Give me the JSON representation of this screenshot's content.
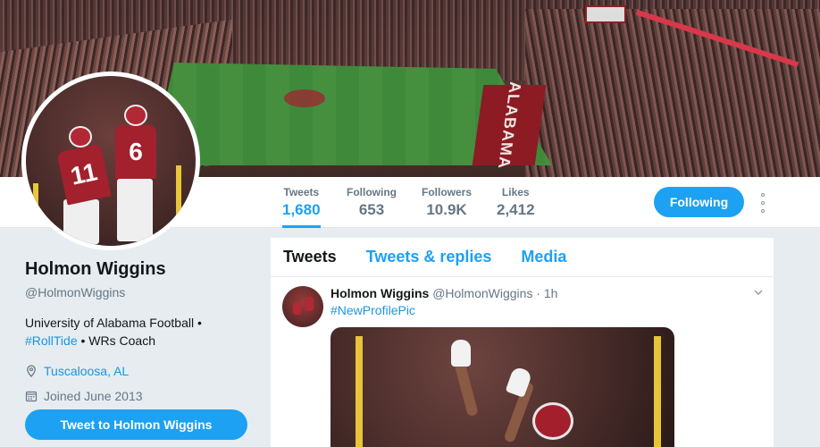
{
  "banner": {
    "endzone_text": "ALABAMA"
  },
  "avatar": {
    "jersey_1": "11",
    "jersey_2": "6"
  },
  "stats": [
    {
      "label": "Tweets",
      "value": "1,680"
    },
    {
      "label": "Following",
      "value": "653"
    },
    {
      "label": "Followers",
      "value": "10.9K"
    },
    {
      "label": "Likes",
      "value": "2,412"
    }
  ],
  "follow_button": "Following",
  "profile": {
    "name": "Holmon Wiggins",
    "handle": "@HolmonWiggins",
    "bio_text": "University of Alabama Football •",
    "bio_hashtag": "#RollTide",
    "bio_suffix": " • WRs Coach",
    "location": "Tuscaloosa, AL",
    "joined": "Joined June 2013",
    "tweet_to_button": "Tweet to Holmon Wiggins"
  },
  "timeline": {
    "tabs": [
      "Tweets",
      "Tweets & replies",
      "Media"
    ],
    "tweet": {
      "name": "Holmon Wiggins",
      "handle_time": "@HolmonWiggins · 1h",
      "hashtag": "#NewProfilePic"
    }
  },
  "colors": {
    "accent": "#1da1f2",
    "link": "#1b95e0",
    "background": "#e6ecf0"
  },
  "icons": [
    "location-pin-icon",
    "calendar-icon",
    "more-dots-icon",
    "chevron-down-icon"
  ]
}
